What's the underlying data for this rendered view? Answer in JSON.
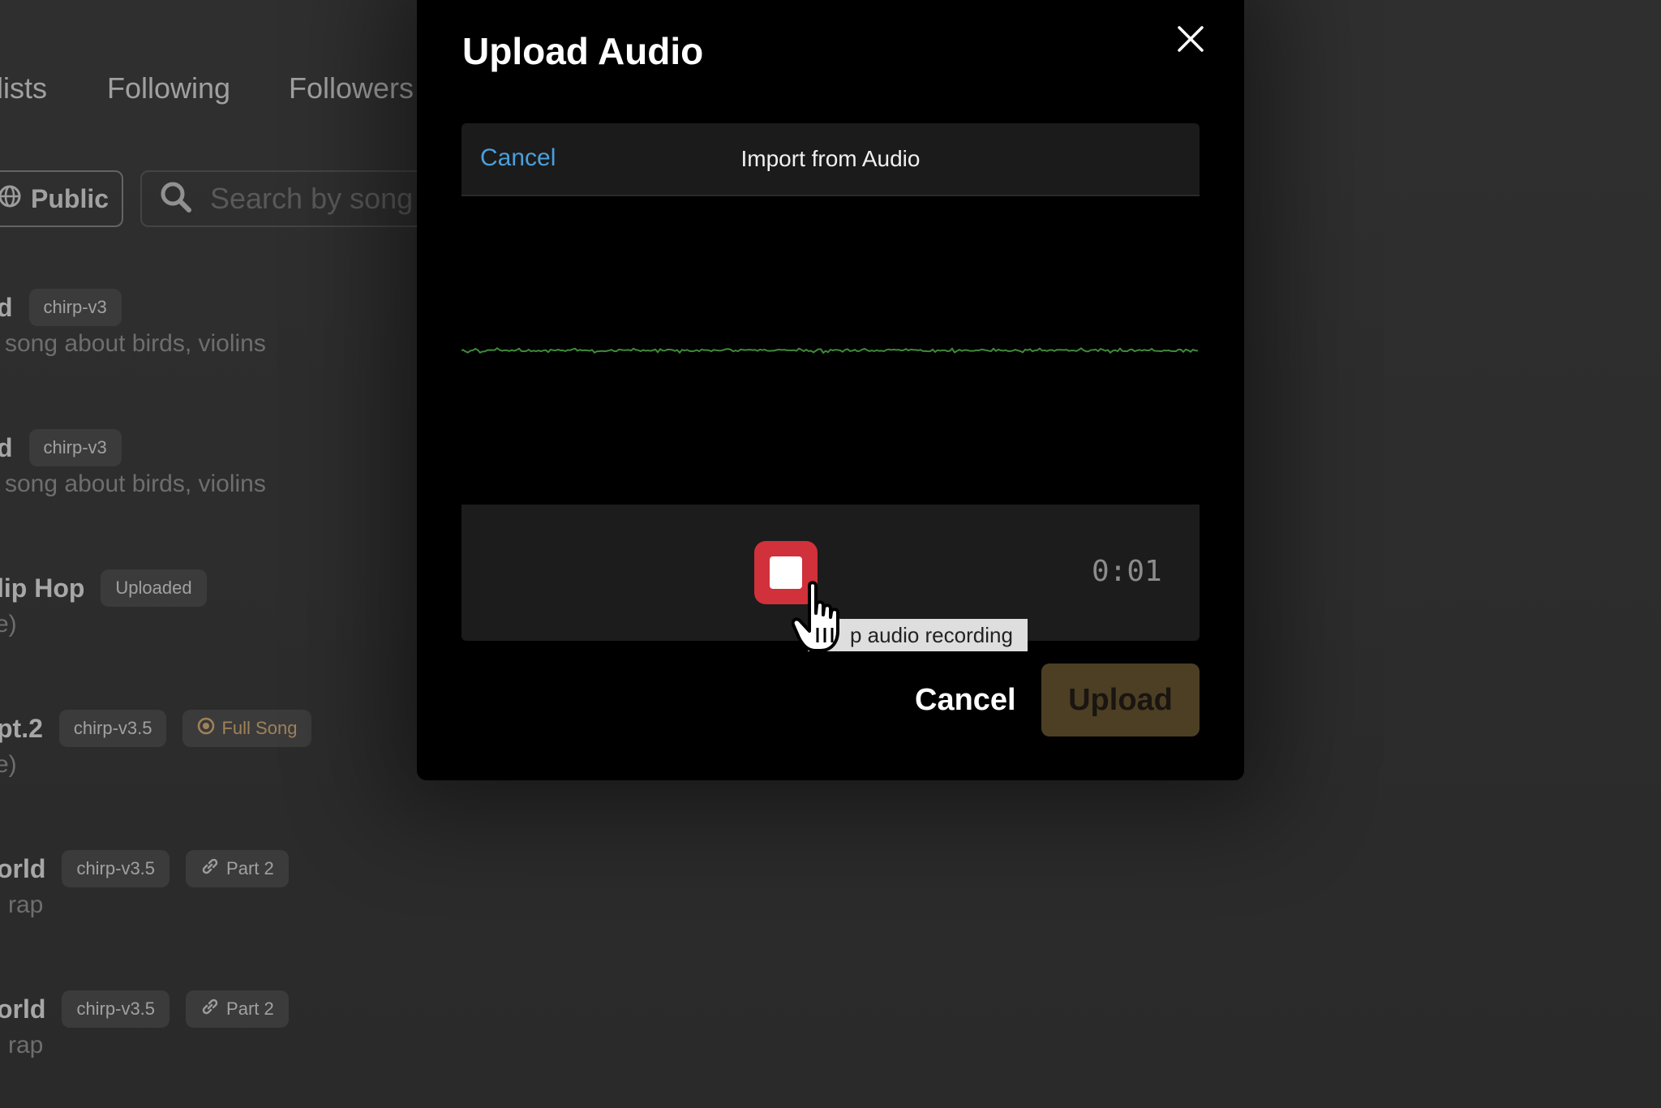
{
  "background": {
    "tabs": [
      {
        "label": "lists"
      },
      {
        "label": "Following"
      },
      {
        "label": "Followers"
      }
    ],
    "filter": {
      "label": "Public"
    },
    "search": {
      "placeholder": "Search by song"
    },
    "songs": [
      {
        "title": "d",
        "badges": [
          {
            "label": "chirp-v3"
          }
        ],
        "description": "song about birds, violins"
      },
      {
        "title": "d",
        "badges": [
          {
            "label": "chirp-v3"
          }
        ],
        "description": "song about birds, violins"
      },
      {
        "title": "lip Hop",
        "badges": [
          {
            "label": "Uploaded"
          }
        ],
        "description": "e)"
      },
      {
        "title": "pt.2",
        "badges": [
          {
            "label": "chirp-v3.5"
          },
          {
            "label": "Full Song",
            "icon": "target-icon"
          }
        ],
        "description": "e)"
      },
      {
        "title": "orld",
        "badges": [
          {
            "label": "chirp-v3.5"
          },
          {
            "label": "Part 2",
            "icon": "link-icon"
          }
        ],
        "description": "rap"
      },
      {
        "title": "orld",
        "badges": [
          {
            "label": "chirp-v3.5"
          },
          {
            "label": "Part 2",
            "icon": "link-icon"
          }
        ],
        "description": "rap"
      }
    ]
  },
  "modal": {
    "title": "Upload Audio",
    "close_icon": "close-icon",
    "recorder": {
      "cancel_label": "Cancel",
      "heading": "Import from Audio",
      "timer": "0:01",
      "stop_icon": "stop-icon",
      "tooltip": "p audio recording"
    },
    "footer": {
      "cancel_label": "Cancel",
      "upload_label": "Upload"
    }
  },
  "colors": {
    "accent_link": "#4a9fdc",
    "record_red": "#d0313a",
    "waveform_green": "#3f8a3a",
    "upload_disabled": "#4d3f24",
    "gold_badge": "#e6b97a"
  }
}
